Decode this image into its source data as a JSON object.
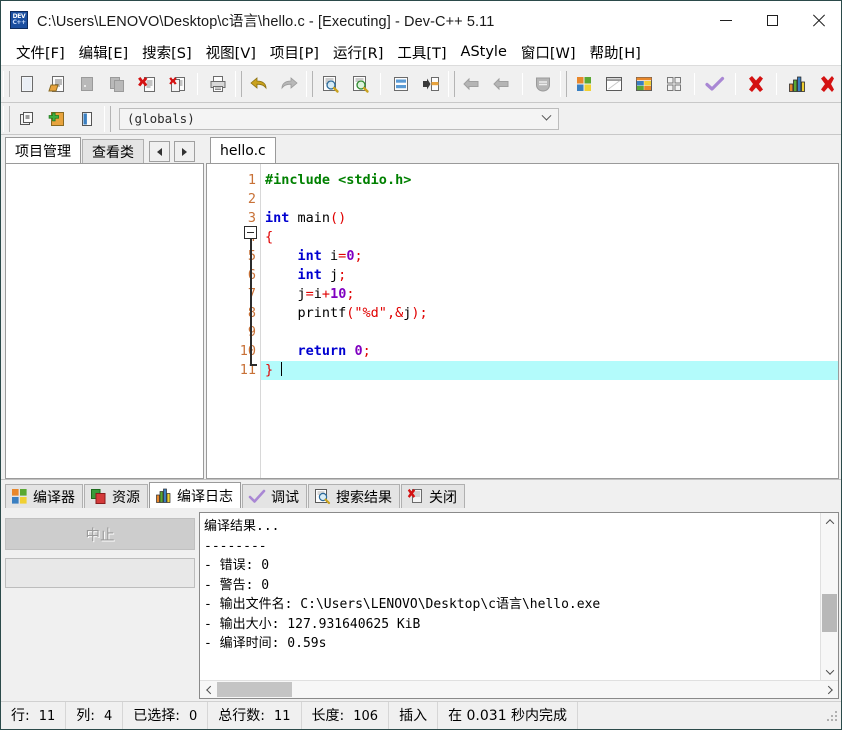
{
  "window": {
    "title": "C:\\Users\\LENOVO\\Desktop\\c语言\\hello.c - [Executing] - Dev-C++ 5.11",
    "icon_label_top": "DEV",
    "icon_label_bottom": "C++",
    "controls": {
      "minimize": "minimize-icon",
      "maximize": "maximize-icon",
      "close": "close-icon"
    }
  },
  "menubar": {
    "items": [
      {
        "label": "文件[F]"
      },
      {
        "label": "编辑[E]"
      },
      {
        "label": "搜索[S]"
      },
      {
        "label": "视图[V]"
      },
      {
        "label": "项目[P]"
      },
      {
        "label": "运行[R]"
      },
      {
        "label": "工具[T]"
      },
      {
        "label": "AStyle"
      },
      {
        "label": "窗口[W]"
      },
      {
        "label": "帮助[H]"
      }
    ]
  },
  "toolbar": {
    "groups": [
      {
        "icons": [
          "new-file-icon",
          "open-file-icon",
          "save-file-icon",
          "save-all-icon",
          "close-file-icon",
          "close-all-icon",
          "print-icon"
        ]
      },
      {
        "icons": [
          "undo-icon",
          "redo-icon"
        ]
      },
      {
        "icons": [
          "find-icon",
          "replace-icon",
          "goto-line-icon",
          "goto-function-icon"
        ]
      },
      {
        "icons": [
          "back-icon",
          "forward-icon",
          "profile-icon"
        ]
      },
      {
        "icons": [
          "compile-icon",
          "run-icon",
          "compile-run-icon",
          "rebuild-icon",
          "syntax-check-icon",
          "stop-execution-icon",
          "profile-analysis-icon",
          "debug-icon"
        ]
      }
    ]
  },
  "globals_bar": {
    "icons": [
      "insert-snippet-icon",
      "add-item-icon",
      "toggle-panel-icon"
    ],
    "combo": {
      "value": "(globals)",
      "arrow": "chevron-down-icon"
    }
  },
  "left_panel": {
    "tabs": [
      {
        "label": "项目管理",
        "active": true
      },
      {
        "label": "查看类",
        "active": false
      }
    ],
    "nav": {
      "prev": "arrow-left-icon",
      "next": "arrow-right-icon"
    },
    "content": ""
  },
  "editor": {
    "tabs": [
      {
        "label": "hello.c",
        "active": true
      }
    ],
    "current_line": 11,
    "lines": [
      {
        "num": "1",
        "tokens": [
          {
            "t": "pre",
            "v": "#include"
          },
          {
            "t": "id",
            "v": " "
          },
          {
            "t": "inc",
            "v": "<stdio.h>"
          }
        ]
      },
      {
        "num": "2",
        "tokens": []
      },
      {
        "num": "3",
        "tokens": [
          {
            "t": "kw",
            "v": "int"
          },
          {
            "t": "id",
            "v": " main"
          },
          {
            "t": "sym",
            "v": "()"
          }
        ]
      },
      {
        "num": "4",
        "tokens": [
          {
            "t": "sym",
            "v": "{"
          }
        ]
      },
      {
        "num": "5",
        "tokens": [
          {
            "t": "id",
            "v": "    "
          },
          {
            "t": "kw",
            "v": "int"
          },
          {
            "t": "id",
            "v": " i"
          },
          {
            "t": "sym",
            "v": "="
          },
          {
            "t": "num",
            "v": "0"
          },
          {
            "t": "sym",
            "v": ";"
          }
        ]
      },
      {
        "num": "6",
        "tokens": [
          {
            "t": "id",
            "v": "    "
          },
          {
            "t": "kw",
            "v": "int"
          },
          {
            "t": "id",
            "v": " j"
          },
          {
            "t": "sym",
            "v": ";"
          }
        ]
      },
      {
        "num": "7",
        "tokens": [
          {
            "t": "id",
            "v": "    j"
          },
          {
            "t": "sym",
            "v": "="
          },
          {
            "t": "id",
            "v": "i"
          },
          {
            "t": "sym",
            "v": "+"
          },
          {
            "t": "num",
            "v": "10"
          },
          {
            "t": "sym",
            "v": ";"
          }
        ]
      },
      {
        "num": "8",
        "tokens": [
          {
            "t": "id",
            "v": "    printf"
          },
          {
            "t": "sym",
            "v": "("
          },
          {
            "t": "str",
            "v": "\"%d\""
          },
          {
            "t": "sym",
            "v": ",&"
          },
          {
            "t": "id",
            "v": "j"
          },
          {
            "t": "sym",
            "v": ");"
          }
        ]
      },
      {
        "num": "9",
        "tokens": []
      },
      {
        "num": "10",
        "tokens": [
          {
            "t": "id",
            "v": "    "
          },
          {
            "t": "kw",
            "v": "return"
          },
          {
            "t": "id",
            "v": " "
          },
          {
            "t": "num",
            "v": "0"
          },
          {
            "t": "sym",
            "v": ";"
          }
        ]
      },
      {
        "num": "11",
        "tokens": [
          {
            "t": "sym",
            "v": "}"
          }
        ]
      }
    ]
  },
  "bottom_panel": {
    "tabs": [
      {
        "label": "编译器",
        "icon": "compiler-icon",
        "active": false
      },
      {
        "label": "资源",
        "icon": "resources-icon",
        "active": false
      },
      {
        "label": "编译日志",
        "icon": "compile-log-icon",
        "active": true
      },
      {
        "label": "调试",
        "icon": "debug-check-icon",
        "active": false
      },
      {
        "label": "搜索结果",
        "icon": "search-results-icon",
        "active": false
      },
      {
        "label": "关闭",
        "icon": "close-tab-icon",
        "active": false
      }
    ],
    "abort_button": {
      "label": "中止",
      "enabled": false
    },
    "progress": {
      "value": 0
    },
    "log_lines": [
      "编译结果...",
      "--------",
      "- 错误: 0",
      "- 警告: 0",
      "- 输出文件名: C:\\Users\\LENOVO\\Desktop\\c语言\\hello.exe",
      "- 输出大小: 127.931640625 KiB",
      "- 编译时间: 0.59s"
    ],
    "scrollbars": {
      "v_up": "chevron-up-icon",
      "v_down": "chevron-down-icon",
      "h_left": "chevron-left-icon",
      "h_right": "chevron-right-icon"
    }
  },
  "statusbar": {
    "cells": [
      {
        "label": "行:",
        "value": "11"
      },
      {
        "label": "列:",
        "value": "4"
      },
      {
        "label": "已选择:",
        "value": "0"
      },
      {
        "label": "总行数:",
        "value": "11"
      },
      {
        "label": "长度:",
        "value": "106"
      },
      {
        "label": "插入",
        "value": ""
      },
      {
        "label": "在 0.031 秒内完成",
        "value": ""
      }
    ]
  },
  "colors": {
    "window_bg": "#f0f0f0",
    "editor_bg": "#ffffff",
    "current_line": "#b3fbfb",
    "line_number": "#c87137",
    "keyword": "#0000d0",
    "preprocessor": "#008000",
    "symbol": "#e00000",
    "number": "#8000c0",
    "string": "#e00000"
  }
}
